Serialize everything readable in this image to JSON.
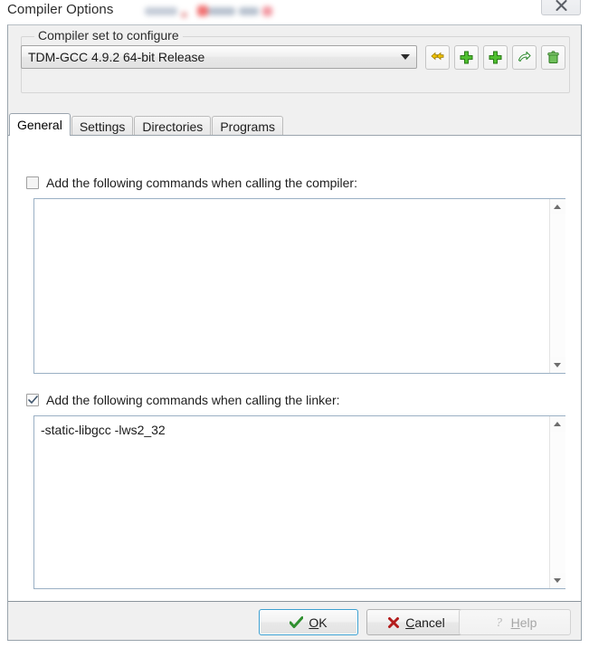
{
  "window": {
    "title": "Compiler Options",
    "title_redacted_note": "blurred-text",
    "close_icon": "close-x-icon"
  },
  "groupbox": {
    "legend": "Compiler set to configure",
    "combo": {
      "value": "TDM-GCC 4.9.2 64-bit Release",
      "arrow_icon": "chevron-down-icon"
    },
    "toolbuttons": [
      {
        "name": "copy-compiler-set-button",
        "icon": "yellow-double-arrow-icon"
      },
      {
        "name": "add-compiler-set-button",
        "icon": "green-plus-icon"
      },
      {
        "name": "duplicate-compiler-set-button",
        "icon": "green-plus-icon"
      },
      {
        "name": "rename-compiler-set-button",
        "icon": "green-arrow-icon"
      },
      {
        "name": "delete-compiler-set-button",
        "icon": "green-trash-icon"
      }
    ]
  },
  "tabs": [
    {
      "label": "General",
      "active": true
    },
    {
      "label": "Settings",
      "active": false
    },
    {
      "label": "Directories",
      "active": false
    },
    {
      "label": "Programs",
      "active": false
    }
  ],
  "general": {
    "compiler": {
      "checkbox_label": "Add the following commands when calling the compiler:",
      "checked": false,
      "text": ""
    },
    "linker": {
      "checkbox_label": "Add the following commands when calling the linker:",
      "checked": true,
      "text": "-static-libgcc -lws2_32"
    }
  },
  "buttons": {
    "ok": {
      "label": "OK",
      "accel": "O",
      "icon": "green-check-icon"
    },
    "cancel": {
      "label": "Cancel",
      "accel": "C",
      "icon": "red-x-icon"
    },
    "help": {
      "label": "Help",
      "accel": "H",
      "icon": "question-mark-icon",
      "disabled": true
    }
  },
  "colors": {
    "accent_focus": "#3c9fd0",
    "ok_check": "#2f8f2f",
    "cancel_x": "#b31c1c",
    "dialog_bg": "#f0f0f0",
    "panel_bg": "#ffffff"
  }
}
